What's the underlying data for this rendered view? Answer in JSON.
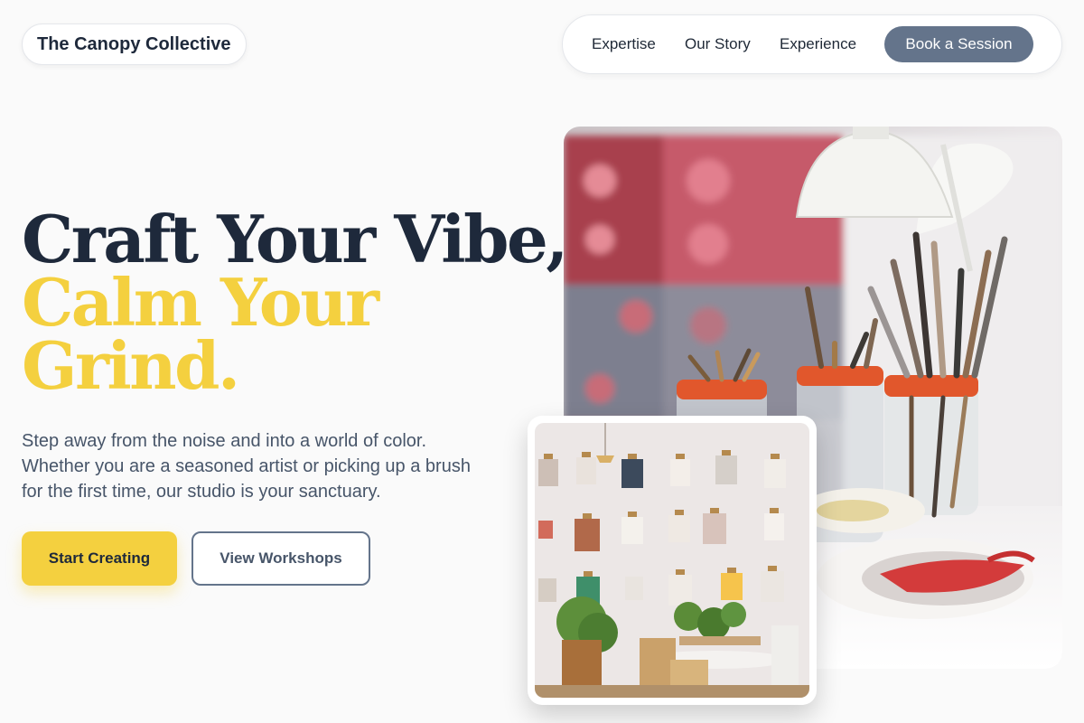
{
  "brand": {
    "name": "The Canopy Collective"
  },
  "nav": {
    "links": [
      "Expertise",
      "Our Story",
      "Experience"
    ],
    "cta": "Book a Session"
  },
  "hero": {
    "headline_line1": "Craft Your Vibe,",
    "headline_line2": "Calm Your",
    "headline_line3": "Grind.",
    "subtitle": "Step away from the noise and into a world of color. Whether you are a seasoned artist or picking up a brush for the first time, our studio is your sanctuary.",
    "primary_button": "Start Creating",
    "secondary_button": "View Workshops"
  },
  "images": {
    "main": "art-studio-brushes-photo",
    "inset": "gallery-wall-photo"
  },
  "colors": {
    "accent": "#f4d03f",
    "dark": "#1e293b",
    "slate": "#64748b",
    "background": "#fafafa"
  }
}
